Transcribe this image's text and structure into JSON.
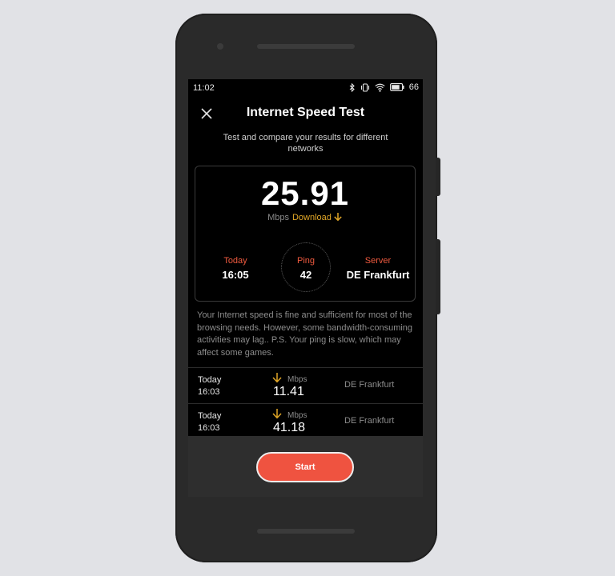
{
  "status_bar": {
    "time": "11:02",
    "battery_percent": "66",
    "icons": [
      "bluetooth-icon",
      "vibrate-icon",
      "wifi-icon",
      "battery-icon"
    ]
  },
  "header": {
    "close_icon": "close-icon",
    "title": "Internet Speed Test",
    "subtitle": "Test and compare your results for different networks"
  },
  "result": {
    "speed": "25.91",
    "unit": "Mbps",
    "direction_label": "Download",
    "direction_icon": "arrow-down-icon",
    "today_label": "Today",
    "today_value": "16:05",
    "ping_label": "Ping",
    "ping_value": "42",
    "server_label": "Server",
    "server_value": "DE Frankfurt"
  },
  "message": "Your Internet speed is fine and sufficient for most of the browsing needs. However, some bandwidth-consuming activities may lag.. P.S. Your ping is slow, which may affect some games.",
  "history": [
    {
      "day": "Today",
      "time": "16:03",
      "unit": "Mbps",
      "speed": "11.41",
      "server": "DE Frankfurt"
    },
    {
      "day": "Today",
      "time": "16:03",
      "unit": "Mbps",
      "speed": "41.18",
      "server": "DE Frankfurt"
    }
  ],
  "footer": {
    "start_label": "Start"
  },
  "colors": {
    "accent": "#ef5340",
    "download": "#e0a627",
    "background": "#000000"
  }
}
